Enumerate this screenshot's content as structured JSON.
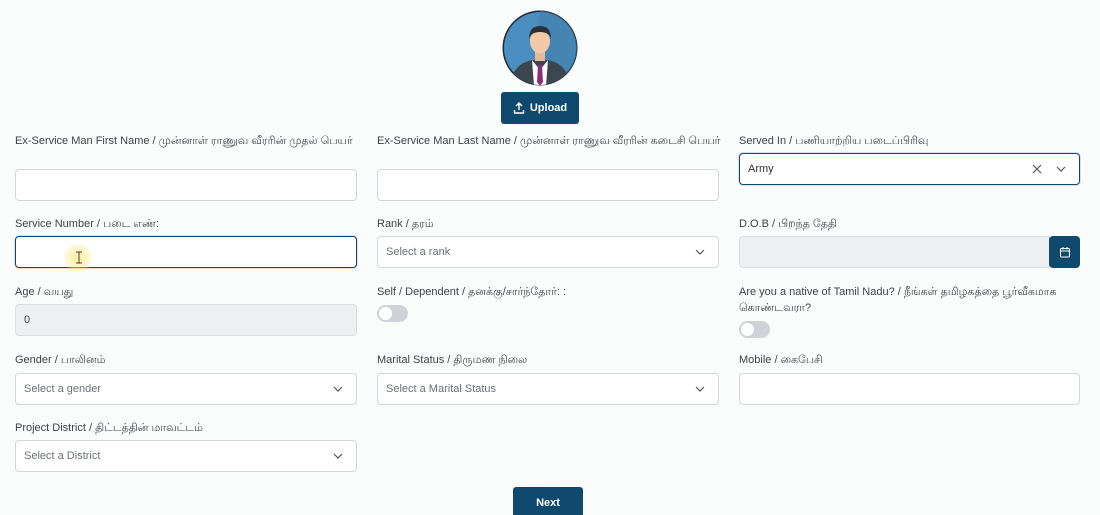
{
  "profile": {
    "upload_label": "Upload"
  },
  "fields": {
    "first_name": {
      "label": "Ex-Service Man First Name / முன்னாள் ராணுவ வீரரின் முதல் பெயர்",
      "value": ""
    },
    "last_name": {
      "label": "Ex-Service Man Last Name / முன்னாள் ராணுவ வீரரின் கடைசி பெயர்",
      "value": ""
    },
    "served_in": {
      "label": "Served In / பணியாற்றிய படைப்பிரிவு",
      "value": "Army"
    },
    "service_number": {
      "label": "Service Number / படை எண்:",
      "value": ""
    },
    "rank": {
      "label": "Rank / தரம்",
      "placeholder": "Select a rank"
    },
    "dob": {
      "label": "D.O.B / பிறந்த தேதி",
      "value": ""
    },
    "age": {
      "label": "Age / வயது",
      "value": "0"
    },
    "self_dependent": {
      "label": "Self / Dependent / தனக்கு/சார்ந்தோர்: :",
      "on": false
    },
    "native_tn": {
      "label": "Are you a native of Tamil Nadu? / நீங்கள் தமிழகத்தை பூர்வீகமாக கொண்டவரா?",
      "on": false
    },
    "gender": {
      "label": "Gender / பாலினம்",
      "placeholder": "Select a gender"
    },
    "marital_status": {
      "label": "Marital Status / திருமண நிலை",
      "placeholder": "Select a Marital Status"
    },
    "mobile": {
      "label": "Mobile / கைபேசி",
      "value": ""
    },
    "project_district": {
      "label": "Project District / திட்டத்தின் மாவட்டம்",
      "placeholder": "Select a District"
    }
  },
  "actions": {
    "next_label": "Next"
  },
  "icons": {
    "upload": "upload-icon",
    "calendar": "calendar-icon",
    "clear": "close-icon",
    "chevron": "chevron-down-icon",
    "avatar": "avatar-icon"
  },
  "colors": {
    "primary": "#0f4a6e",
    "border": "#d3d7db",
    "disabled_bg": "#eef0f1",
    "toggle_off": "#cfd3d7"
  }
}
